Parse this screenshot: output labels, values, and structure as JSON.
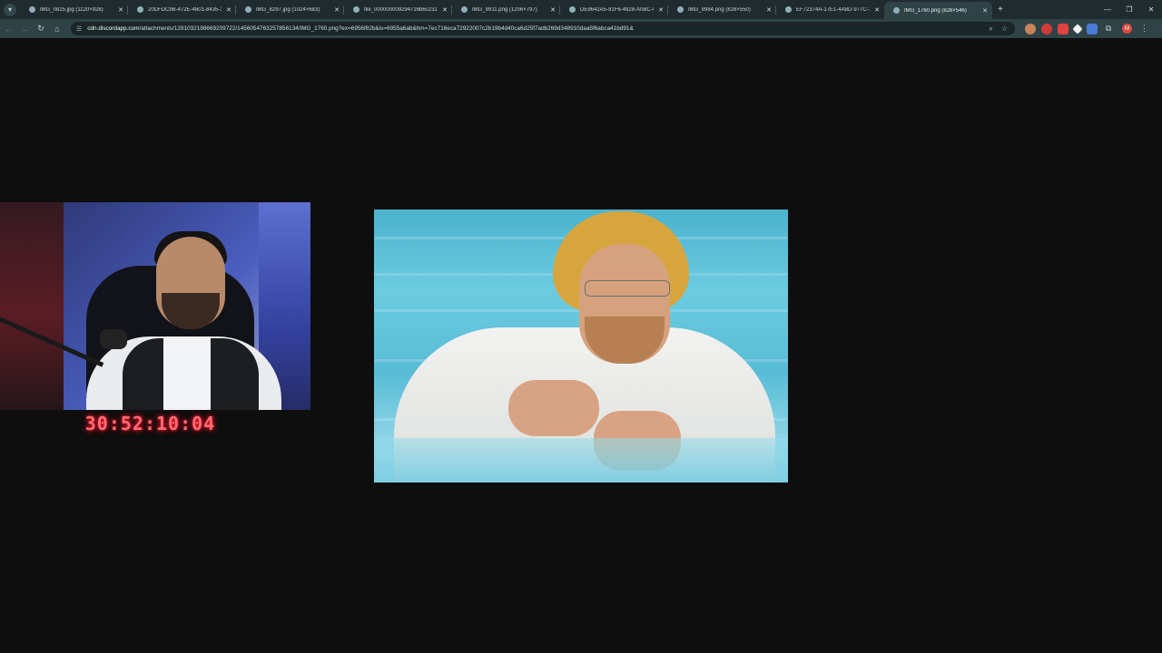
{
  "browser": {
    "tabs": [
      {
        "title": "IMG_0825.jpg (1120×928)",
        "active": false
      },
      {
        "title": "20DFDC9B-472E-4801-8435-1...",
        "active": false
      },
      {
        "title": "IMG_8297.jpg (1024×683)",
        "active": false
      },
      {
        "title": "file_000000009294716b6c231...",
        "active": false
      },
      {
        "title": "IMG_9911.png (1206×797)",
        "active": false
      },
      {
        "title": "DE9642A5-91F6-4928-A0BC-0...",
        "active": false
      },
      {
        "title": "IMG_9984.png (828×550)",
        "active": false
      },
      {
        "title": "EF72374A-17E1-4A8D-977C-1...",
        "active": false
      },
      {
        "title": "IMG_1760.png (828×546)",
        "active": true
      }
    ],
    "address_host": "cdn.discordapp.com",
    "address_path": "/attachments/1281032198669209722/1456054763257856134/IMG_1760.png?ex=6956f82b&is=6955a6ab&hm=7ec716eca72922007c2b19b4d40ca6d25f7adb269d348910daa5f6abca41bd91&",
    "profile_initial": "M",
    "icons": {
      "tab_search": "chevron-down-icon",
      "new_tab": "plus-icon",
      "back": "back-arrow-icon",
      "forward": "forward-arrow-icon",
      "reload": "reload-icon",
      "home": "home-icon",
      "site_info": "site-info-icon",
      "zoom": "zoom-icon",
      "bookmark": "star-icon",
      "extensions": "puzzle-icon",
      "menu": "kebab-menu-icon"
    },
    "colors": {
      "frame": "#1f2b2e",
      "toolbar": "#2f4347",
      "omnibox": "#1a2528",
      "page_background": "#0e0e0e"
    }
  },
  "content": {
    "countdown_timer": "30:52:10:04",
    "timer_color": "#ff6b74"
  }
}
